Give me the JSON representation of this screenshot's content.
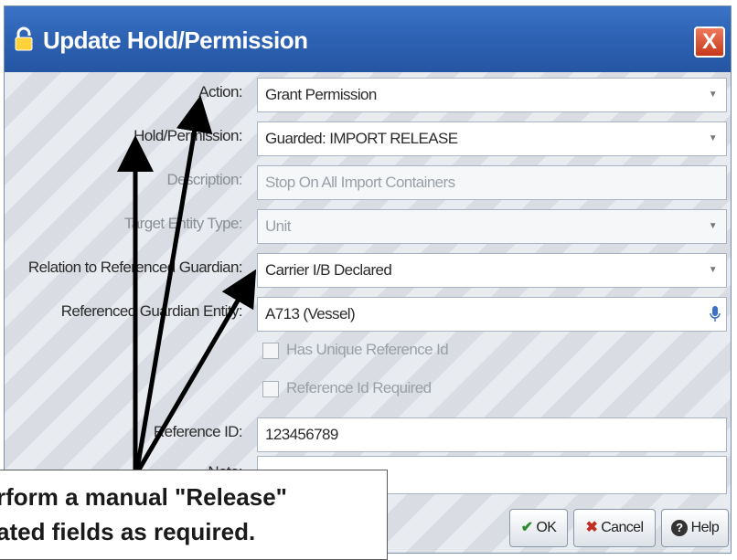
{
  "dialog": {
    "title": "Update Hold/Permission",
    "close_label": "X"
  },
  "form": {
    "action": {
      "label": "Action:",
      "value": "Grant Permission"
    },
    "hold_permission": {
      "label": "Hold/Permission:",
      "value": "Guarded: IMPORT RELEASE"
    },
    "description": {
      "label": "Description:",
      "value": "Stop On All Import Containers"
    },
    "target_entity_type": {
      "label": "Target Entity Type:",
      "value": "Unit"
    },
    "relation": {
      "label": "Relation to Referenced Guardian:",
      "value": "Carrier I/B Declared"
    },
    "referenced_guardian": {
      "label": "Referenced Guardian Entity:",
      "value": "A713 (Vessel)"
    },
    "has_unique_ref": {
      "label": "Has Unique Reference Id"
    },
    "ref_required": {
      "label": "Reference Id Required"
    },
    "reference_id": {
      "label": "Reference ID:",
      "value": "123456789"
    },
    "note": {
      "label": "Note:",
      "value": ""
    }
  },
  "buttons": {
    "ok": "OK",
    "cancel": "Cancel",
    "help": "Help"
  },
  "callout": {
    "line1": "rform a manual \"Release\"",
    "line2": "ated fields as required."
  },
  "colors": {
    "titlebar": "#2e63b4",
    "close": "#d8482a",
    "arrow": "#000000"
  }
}
